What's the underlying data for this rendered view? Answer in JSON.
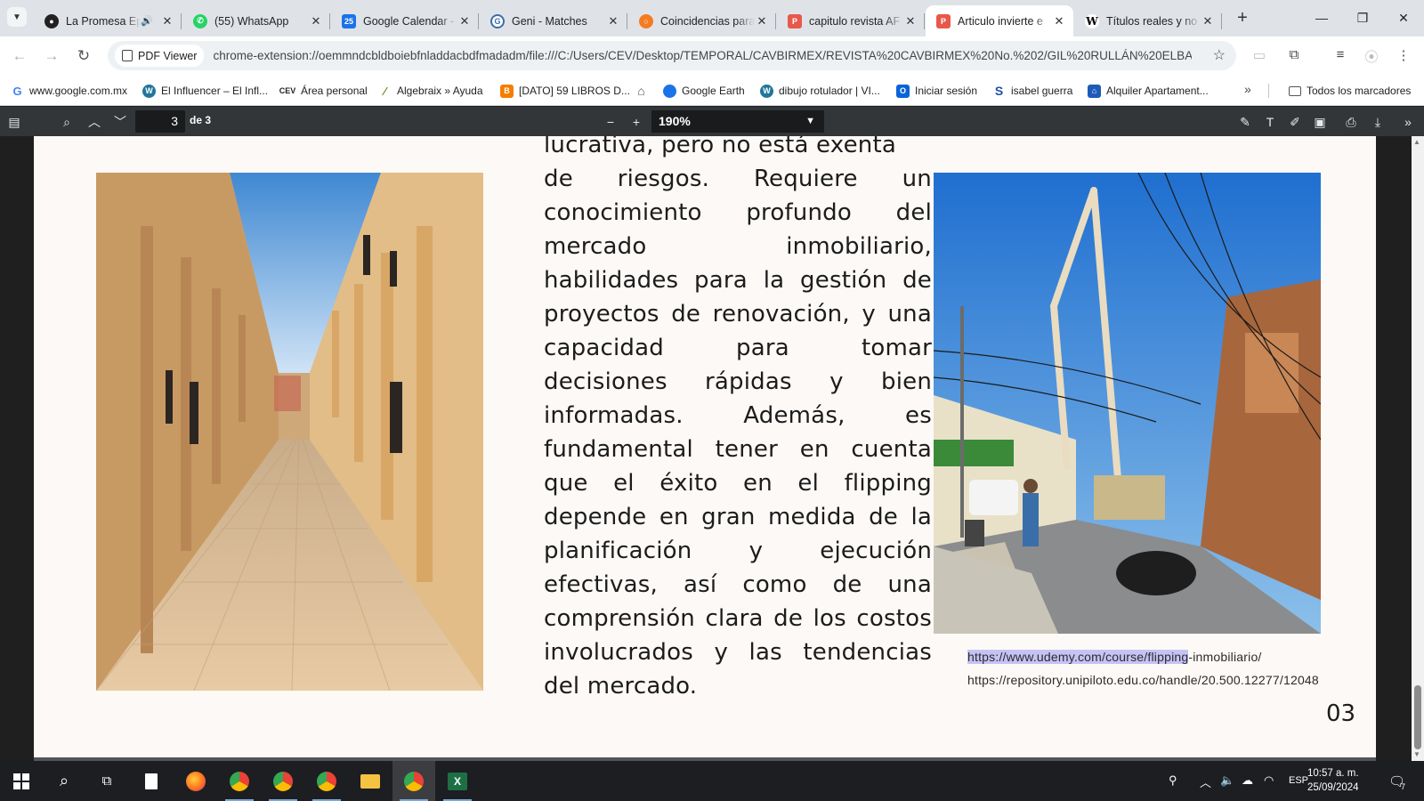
{
  "tabs": [
    {
      "title": "La Promesa Ep",
      "favicon": "promesa-icon",
      "audio": true
    },
    {
      "title": "(55) WhatsApp",
      "favicon": "whatsapp-icon"
    },
    {
      "title": "Google Calendar -",
      "favicon": "calendar-icon"
    },
    {
      "title": "Geni - Matches",
      "favicon": "geni-icon"
    },
    {
      "title": "Coincidencias para",
      "favicon": "coincidencias-icon"
    },
    {
      "title": "capitulo revista AF",
      "favicon": "pdf-icon"
    },
    {
      "title": "Articulo invierte e",
      "favicon": "pdf-icon",
      "active": true
    },
    {
      "title": "Títulos reales y no",
      "favicon": "wikipedia-icon"
    }
  ],
  "toolbar": {
    "site_chip": "PDF Viewer",
    "url": "chrome-extension://oemmndcbldboiebfnladdacbdfmadadm/file:///C:/Users/CEV/Desktop/TEMPORAL/CAVBIRMEX/REVISTA%20CAVBIRMEX%20No.%202/GIL%20RULLÁN%20ELBA..."
  },
  "bookmarks": [
    {
      "label": "www.google.com.mx",
      "icon": "google-icon",
      "color": "#4285f4"
    },
    {
      "label": "El Influencer – El Infl...",
      "icon": "wordpress-icon",
      "color": "#21759b"
    },
    {
      "label": "Área personal",
      "icon": "cev-icon",
      "color": "#222222"
    },
    {
      "label": "Algebraix » Ayuda",
      "icon": "algebraix-icon",
      "color": "#5b8c2a"
    },
    {
      "label": "[DATO] 59 LIBROS D...",
      "icon": "blogger-icon",
      "color": "#f57d00"
    },
    {
      "label": "",
      "icon": "home-icon",
      "color": "#555555"
    },
    {
      "label": "Google Earth",
      "icon": "earth-icon",
      "color": "#1a73e8"
    },
    {
      "label": "dibujo rotulador | VI...",
      "icon": "wordpress-icon",
      "color": "#21759b"
    },
    {
      "label": "Iniciar sesión",
      "icon": "outlook-icon",
      "color": "#0a64d8"
    },
    {
      "label": "isabel guerra",
      "icon": "s-icon",
      "color": "#1f4fa8"
    },
    {
      "label": "Alquiler Apartament...",
      "icon": "house-icon",
      "color": "#1e5bb8"
    }
  ],
  "bookmarks_all": "Todos los marcadores",
  "pdf": {
    "page_current": "3",
    "page_total": "de 3",
    "zoom": "190%"
  },
  "document": {
    "partial_top": "lucrativa, pero no está exenta",
    "body": "de riesgos. Requiere un conocimiento profundo del mercado inmobiliario, habilidades para la gestión de proyectos de renovación, y una capacidad para tomar decisiones rápidas y bien informadas. Además, es fundamental tener en cuenta que el éxito en el flipping depende en gran medida de la planificación y ejecución efectivas, así como de una comprensión clara de los costos involucrados y las tendencias del mercado.",
    "link1_highlighted": "https://www.udemy.com/course/flipping",
    "link1_rest": "-inmobiliario/",
    "link2": "https://repository.unipiloto.edu.co/handle/20.500.12277/12048",
    "page_number": "03"
  },
  "taskbar": {
    "language": "ESP",
    "time": "10:57 a. m.",
    "date": "25/09/2024",
    "notifications": "7"
  }
}
